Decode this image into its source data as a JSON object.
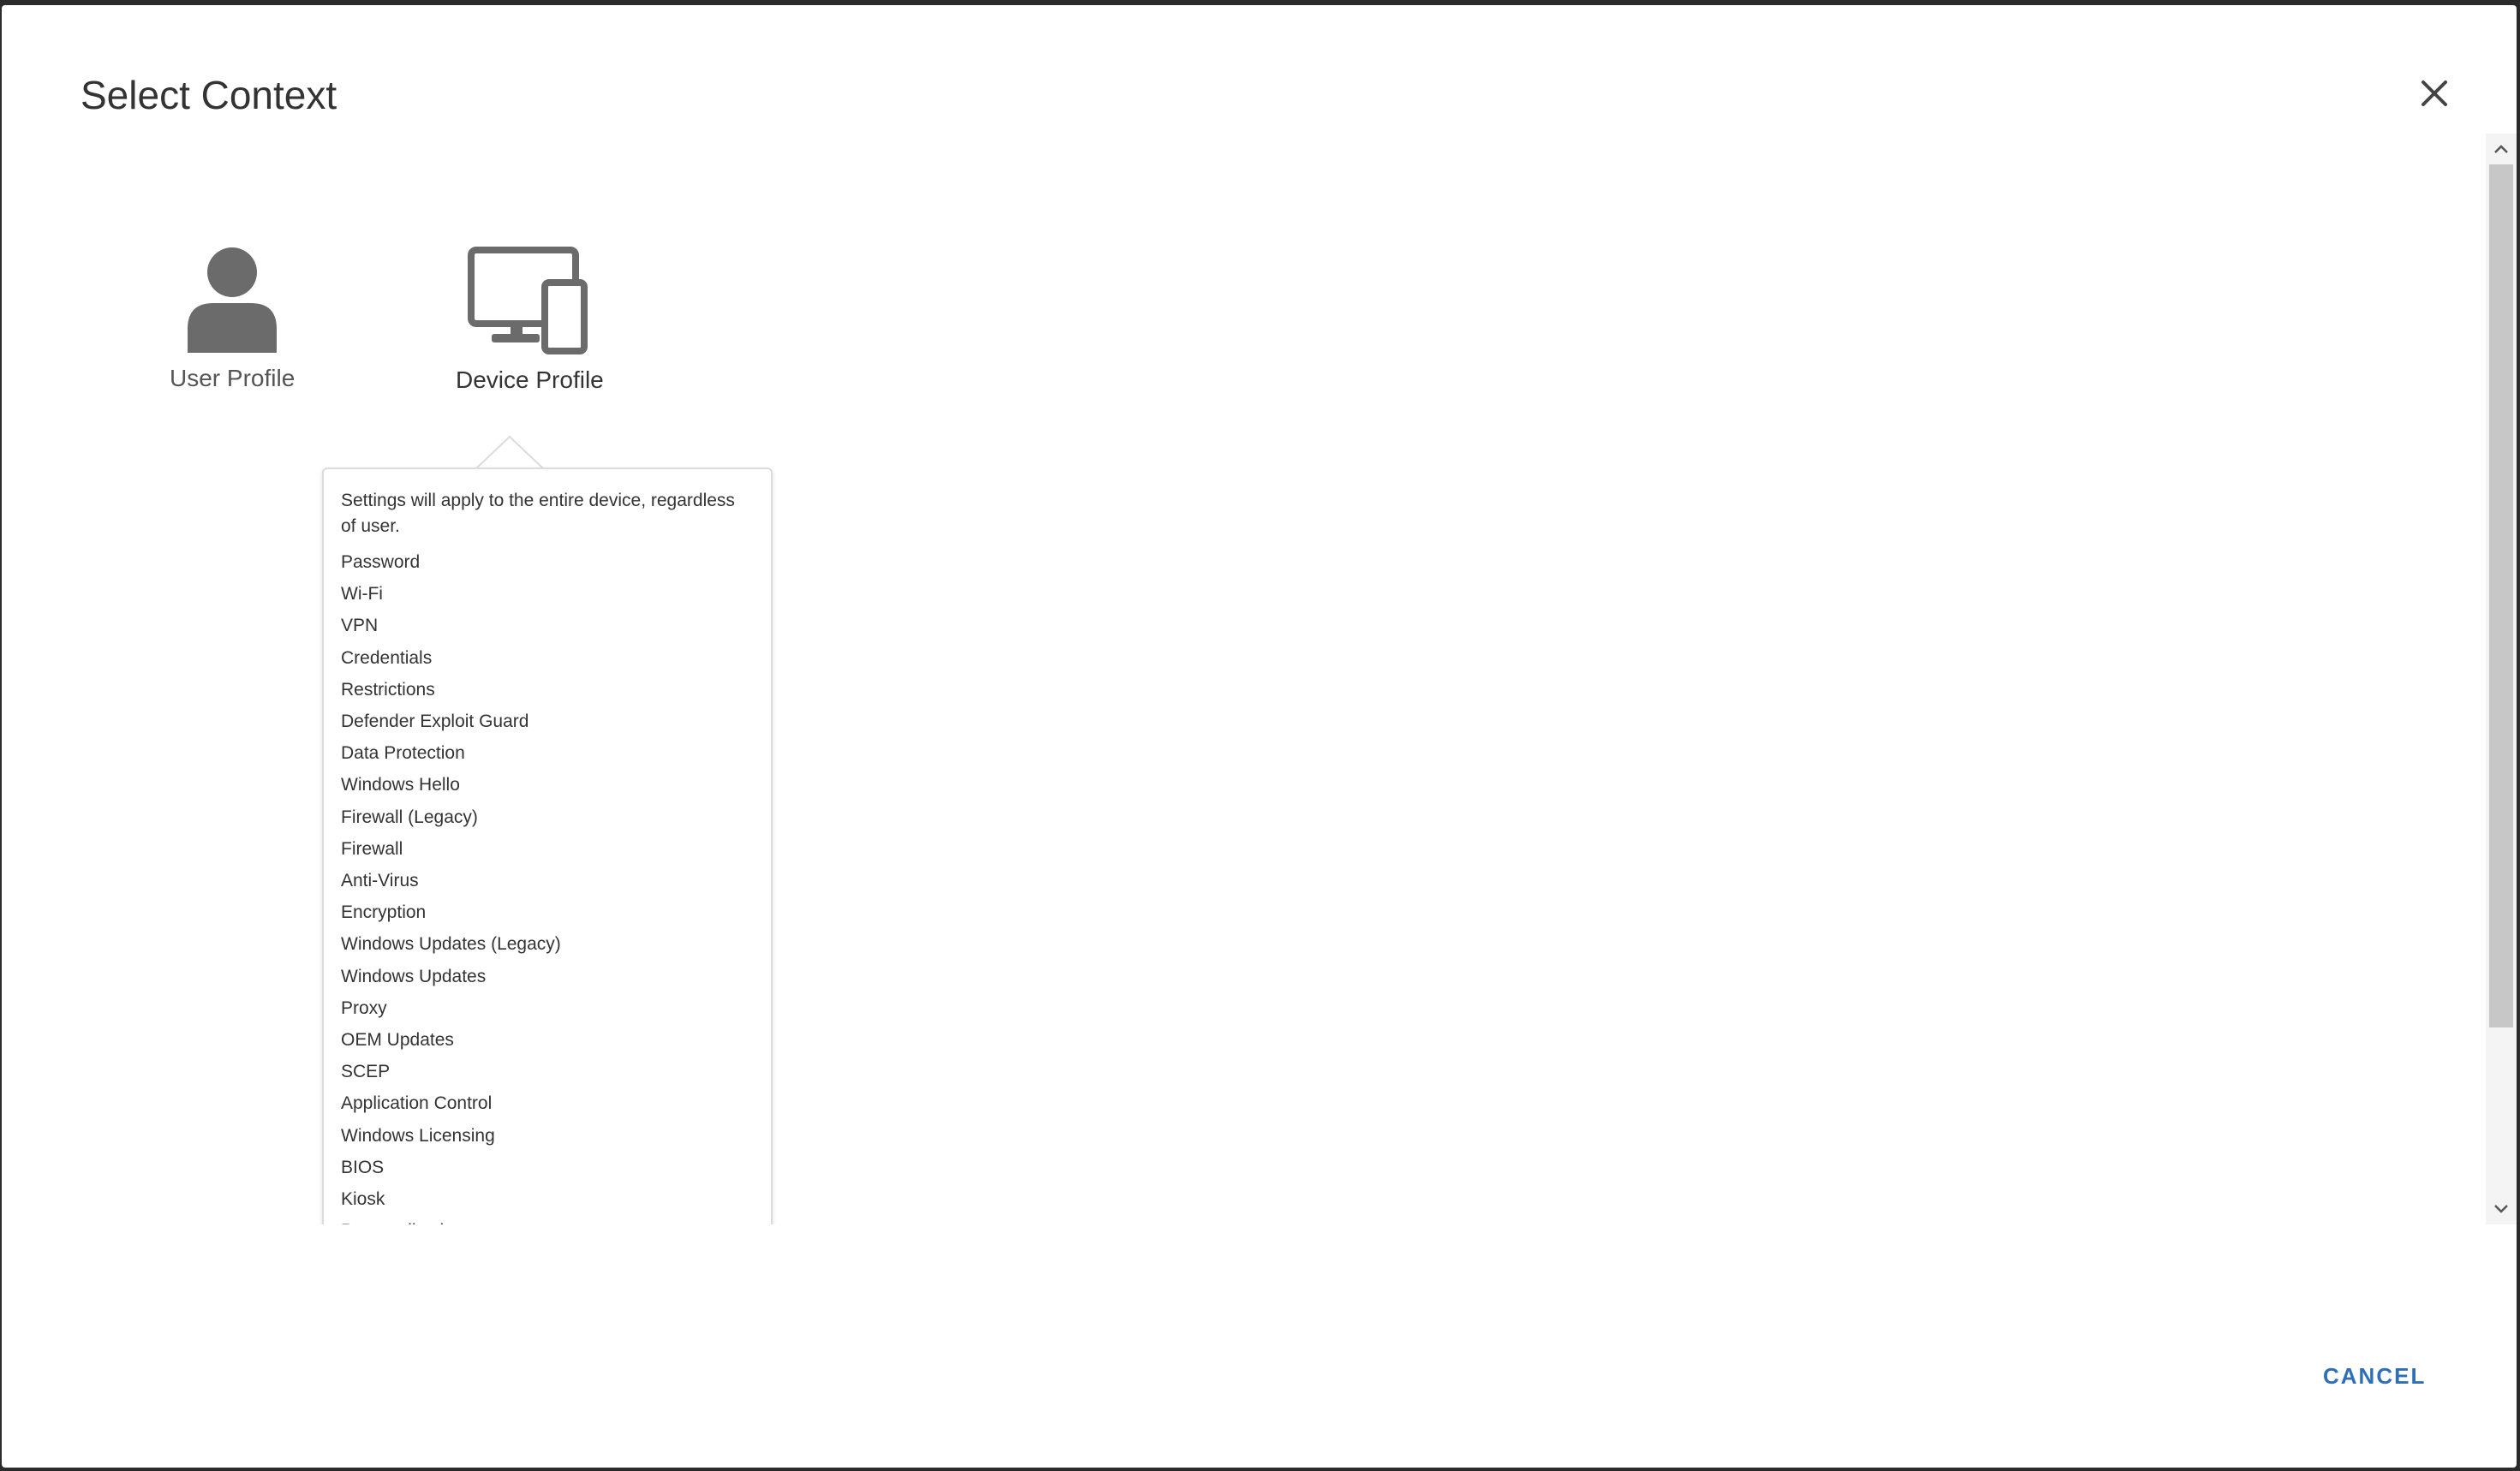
{
  "dialog": {
    "title": "Select Context",
    "close_icon": "close-icon"
  },
  "tiles": {
    "user": {
      "label": "User Profile",
      "icon": "user-icon"
    },
    "device": {
      "label": "Device Profile",
      "icon": "devices-icon"
    }
  },
  "popover": {
    "description": "Settings will apply to the entire device, regardless of user.",
    "items": [
      "Password",
      "Wi-Fi",
      "VPN",
      "Credentials",
      "Restrictions",
      "Defender Exploit Guard",
      "Data Protection",
      "Windows Hello",
      "Firewall (Legacy)",
      "Firewall",
      "Anti-Virus",
      "Encryption",
      "Windows Updates (Legacy)",
      "Windows Updates",
      "Proxy",
      "OEM Updates",
      "SCEP",
      "Application Control",
      "Windows Licensing",
      "BIOS",
      "Kiosk",
      "Personalization"
    ]
  },
  "footer": {
    "cancel_label": "CANCEL"
  },
  "colors": {
    "icon_gray": "#6b6b6b",
    "accent": "#2f6fb7",
    "text": "#333333"
  }
}
